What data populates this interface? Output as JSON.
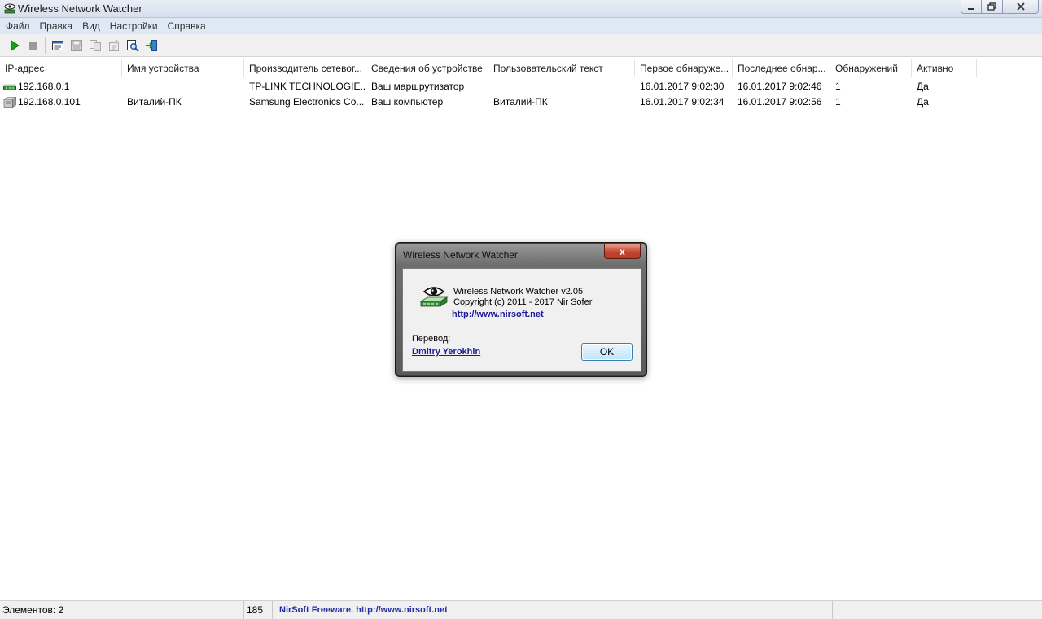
{
  "window": {
    "title": "Wireless Network Watcher",
    "app_icon": "network-device-icon"
  },
  "menu": {
    "items": [
      "Файл",
      "Правка",
      "Вид",
      "Настройки",
      "Справка"
    ]
  },
  "toolbar": {
    "buttons": [
      {
        "name": "start-scan-button",
        "icon": "play-icon",
        "enabled": true
      },
      {
        "name": "stop-scan-button",
        "icon": "stop-icon",
        "enabled": false
      },
      {
        "name": "html-report-button",
        "icon": "report-icon",
        "enabled": true
      },
      {
        "name": "save-button",
        "icon": "save-icon",
        "enabled": false
      },
      {
        "name": "copy-button",
        "icon": "copy-icon",
        "enabled": false
      },
      {
        "name": "properties-button",
        "icon": "properties-icon",
        "enabled": false
      },
      {
        "name": "find-button",
        "icon": "find-icon",
        "enabled": true
      },
      {
        "name": "exit-button",
        "icon": "exit-icon",
        "enabled": true
      }
    ]
  },
  "list": {
    "columns": [
      "IP-адрес",
      "Имя устройства",
      "Производитель сетевог...",
      "Сведения об устройстве",
      "Пользовательский текст",
      "Первое обнаруже...",
      "Последнее обнар...",
      "Обнаружений",
      "Активно"
    ],
    "rows": [
      {
        "icon": "router-icon",
        "cells": [
          "192.168.0.1",
          "",
          "TP-LINK TECHNOLOGIE...",
          "Ваш маршрутизатор",
          "",
          "16.01.2017 9:02:30",
          "16.01.2017 9:02:46",
          "1",
          "Да"
        ]
      },
      {
        "icon": "computer-icon",
        "cells": [
          "192.168.0.101",
          "Виталий-ПК",
          "Samsung Electronics Co...",
          "Ваш компьютер",
          "Виталий-ПК",
          "16.01.2017 9:02:34",
          "16.01.2017 9:02:56",
          "1",
          "Да"
        ]
      }
    ]
  },
  "statusbar": {
    "items_label": "Элементов: 2",
    "count": "185",
    "link_text": "NirSoft Freeware.  http://www.nirsoft.net"
  },
  "about_dialog": {
    "title": "Wireless Network Watcher",
    "close_label": "x",
    "version_line": "Wireless Network Watcher v2.05",
    "copyright_line": "Copyright (c) 2011 - 2017 Nir Sofer",
    "url": "http://www.nirsoft.net",
    "translator_label": "Перевод:",
    "translator_name": "Dmitry Yerokhin",
    "ok_label": "OK"
  },
  "colors": {
    "menubar_bg": "#dfe8f5",
    "link_color": "#1a1a9c",
    "play_green": "#16a31c",
    "close_red": "#c4452f"
  }
}
